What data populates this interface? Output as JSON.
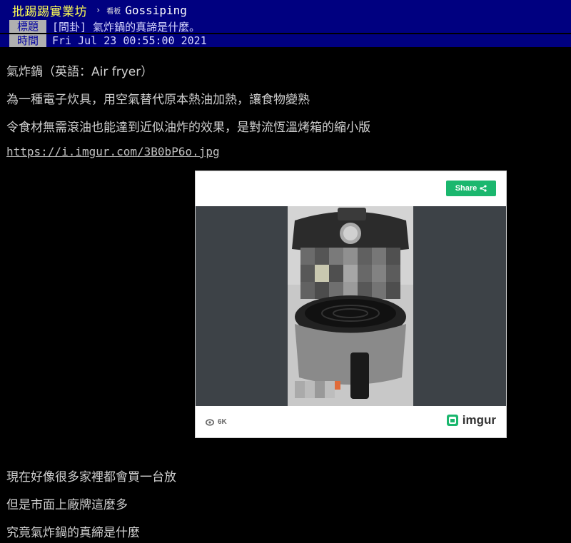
{
  "header": {
    "board_title": "批踢踢實業坊",
    "separator": "›",
    "board_prefix": "看板",
    "board_name": "Gossiping"
  },
  "meta": {
    "title_label": "標題",
    "title_value": "[問卦] 氣炸鍋的真諦是什麼。",
    "time_label": "時間",
    "time_value": "Fri Jul 23 00:55:00 2021"
  },
  "content": {
    "line1": "氣炸鍋（英語：Air fryer）",
    "line2": "為一種電子炊具，用空氣替代原本熱油加熱，讓食物變熟",
    "line3": "令食材無需滾油也能達到近似油炸的效果，是對流恆溫烤箱的縮小版",
    "link": "https://i.imgur.com/3B0bP6o.jpg",
    "line4": "現在好像很多家裡都會買一台放",
    "line5": "但是市面上廠牌這麼多",
    "line6": "究竟氣炸鍋的真締是什麼"
  },
  "embed": {
    "share_label": "Share",
    "views": "6K",
    "brand": "imgur",
    "brand_color": "#1bb76e"
  }
}
